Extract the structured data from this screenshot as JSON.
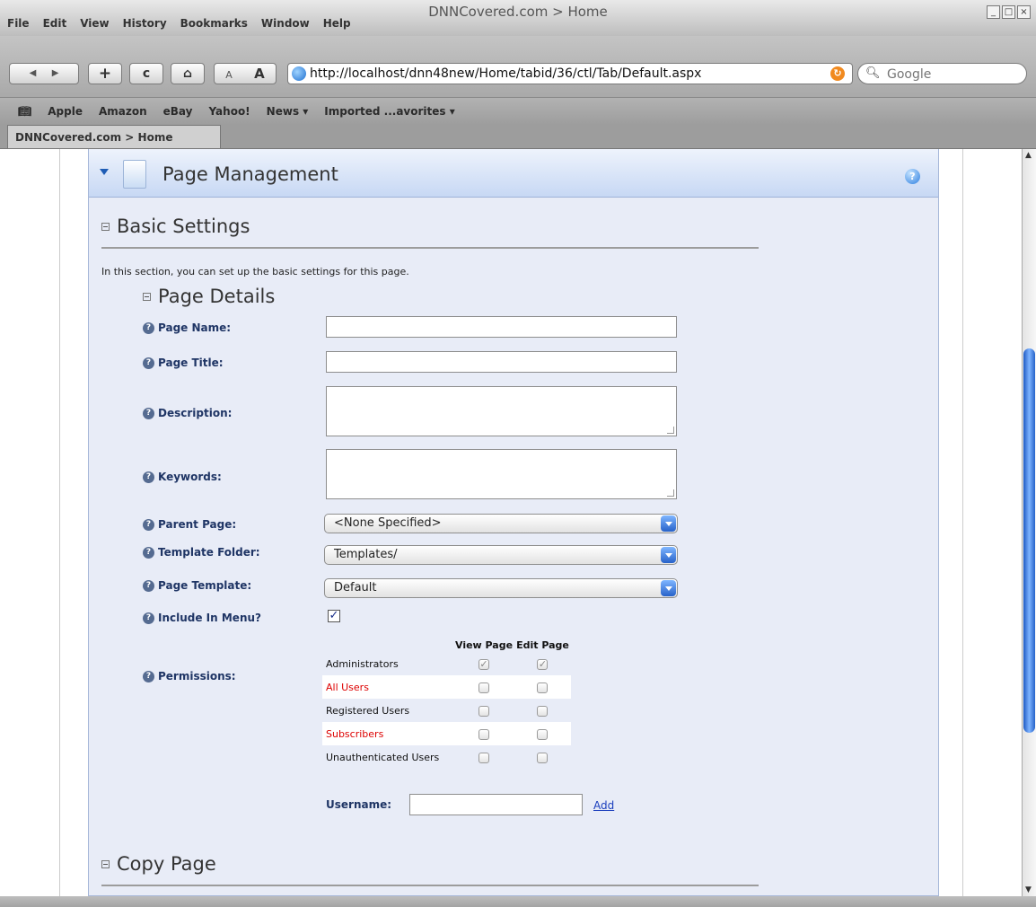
{
  "window": {
    "title": "DNNCovered.com > Home"
  },
  "menu": [
    "File",
    "Edit",
    "View",
    "History",
    "Bookmarks",
    "Window",
    "Help"
  ],
  "toolbar": {
    "back": "◀",
    "forward": "▶",
    "add": "+",
    "reload": "c",
    "home": "⌂",
    "text_smaller": "A",
    "text_larger": "A",
    "url": "http://localhost/dnn48new/Home/tabid/36/ctl/Tab/Default.aspx",
    "search_placeholder": "Google"
  },
  "bookmarks": [
    "Apple",
    "Amazon",
    "eBay",
    "Yahoo!",
    "News ▾",
    "Imported ...avorites ▾"
  ],
  "tab": {
    "label": "DNNCovered.com > Home"
  },
  "module": {
    "title": "Page Management",
    "help": "?",
    "basic_settings": "Basic Settings",
    "intro": "In this section, you can set up the basic settings for this page.",
    "page_details": "Page Details",
    "copy_page": "Copy Page"
  },
  "fields": {
    "page_name": "Page Name:",
    "page_title": "Page Title:",
    "description": "Description:",
    "keywords": "Keywords:",
    "parent_page": "Parent Page:",
    "parent_page_value": "<None Specified>",
    "template_folder": "Template Folder:",
    "template_folder_value": "Templates/",
    "page_template": "Page Template:",
    "page_template_value": "Default",
    "include_in_menu": "Include In Menu?",
    "include_in_menu_checked": true,
    "permissions": "Permissions:"
  },
  "permissions": {
    "col_view": "View Page",
    "col_edit": "Edit Page",
    "rows": [
      {
        "role": "Administrators",
        "view": true,
        "edit": true,
        "red": false
      },
      {
        "role": "All Users",
        "view": false,
        "edit": false,
        "red": true
      },
      {
        "role": "Registered Users",
        "view": false,
        "edit": false,
        "red": false
      },
      {
        "role": "Subscribers",
        "view": false,
        "edit": false,
        "red": true
      },
      {
        "role": "Unauthenticated Users",
        "view": false,
        "edit": false,
        "red": false
      }
    ],
    "username_label": "Username:",
    "add_link": "Add"
  }
}
